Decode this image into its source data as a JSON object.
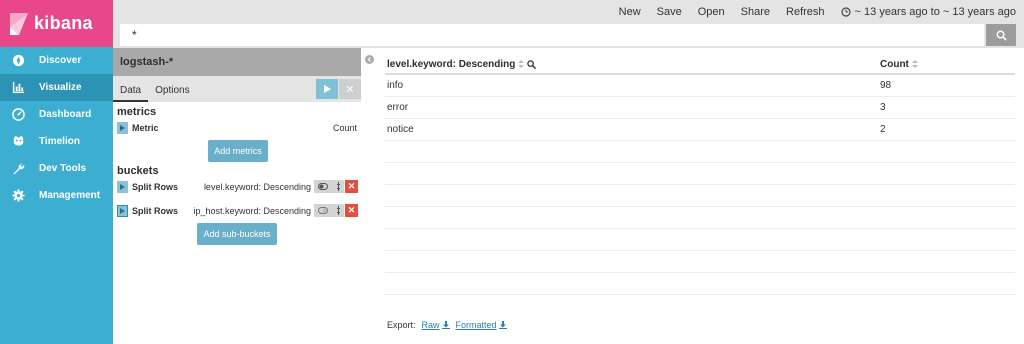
{
  "app": {
    "name": "kibana"
  },
  "sidebar": {
    "items": [
      {
        "label": "Discover",
        "icon": "compass-icon",
        "active": false
      },
      {
        "label": "Visualize",
        "icon": "bar-chart-icon",
        "active": true
      },
      {
        "label": "Dashboard",
        "icon": "dashboard-icon",
        "active": false
      },
      {
        "label": "Timelion",
        "icon": "timelion-icon",
        "active": false
      },
      {
        "label": "Dev Tools",
        "icon": "wrench-icon",
        "active": false
      },
      {
        "label": "Management",
        "icon": "gear-icon",
        "active": false
      }
    ]
  },
  "topnav": {
    "new": "New",
    "save": "Save",
    "open": "Open",
    "share": "Share",
    "refresh": "Refresh",
    "time": "~ 13 years ago to ~ 13 years ago"
  },
  "query": {
    "value": "*"
  },
  "editor": {
    "index_pattern": "logstash-*",
    "tabs": [
      "Data",
      "Options"
    ],
    "metrics_heading": "metrics",
    "metric": {
      "name": "Metric",
      "desc": "Count"
    },
    "add_metrics": "Add metrics",
    "buckets_heading": "buckets",
    "buckets": [
      {
        "name": "Split Rows",
        "desc": "level.keyword: Descending"
      },
      {
        "name": "Split Rows",
        "desc": "ip_host.keyword: Descending"
      }
    ],
    "add_sub_buckets": "Add sub-buckets"
  },
  "table": {
    "headers": [
      "level.keyword: Descending",
      "Count"
    ],
    "rows": [
      [
        "info",
        "98"
      ],
      [
        "error",
        "3"
      ],
      [
        "notice",
        "2"
      ]
    ]
  },
  "export": {
    "label": "Export:",
    "raw": "Raw",
    "formatted": "Formatted"
  },
  "colors": {
    "sidebar": "#3caed2",
    "logo": "#e8488b",
    "accent": "#69afc9",
    "danger": "#e74c3c"
  }
}
